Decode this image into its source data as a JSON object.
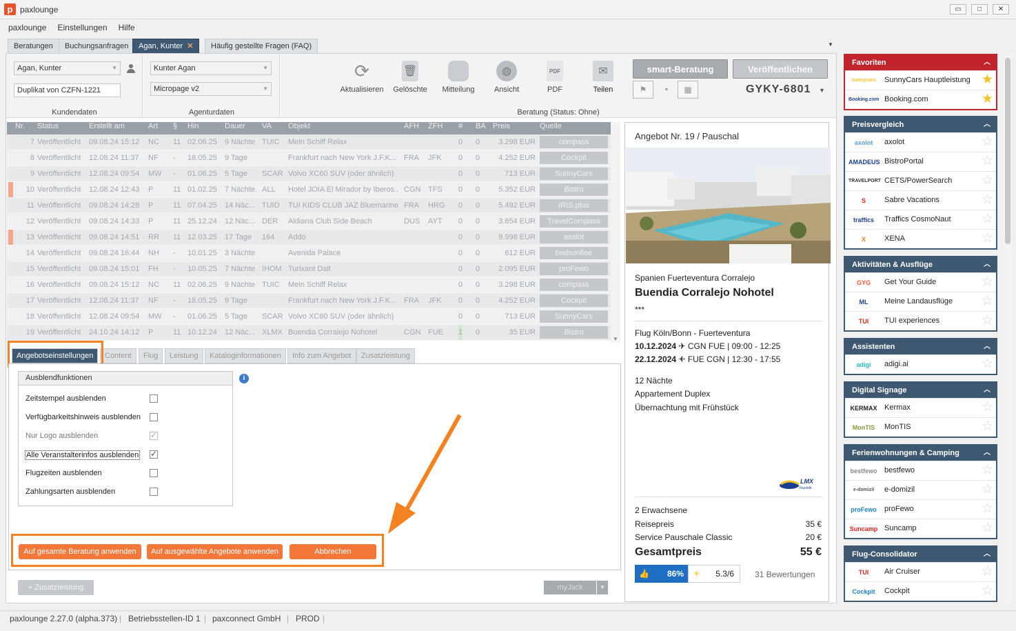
{
  "app": {
    "title": "paxlounge",
    "logo": "p"
  },
  "window_controls": {
    "minimize": "▭",
    "maximize": "□",
    "close": "✕"
  },
  "menu": [
    "paxlounge",
    "Einstellungen",
    "Hilfe"
  ],
  "tabs": [
    {
      "label": "Beratungen"
    },
    {
      "label": "Buchungsanfragen"
    },
    {
      "label": "Agan, Kunter",
      "close": "✕"
    },
    {
      "label": "Häufig gestellte Fragen (FAQ)"
    }
  ],
  "kundendaten": {
    "customer": "Agan, Kunter",
    "copy": "Duplikat von CZFN-1221",
    "label": "Kundendaten"
  },
  "agenturdaten": {
    "agent": "Kunter Agan",
    "template": "Micropage v2",
    "label": "Agenturdaten"
  },
  "toolbar": [
    {
      "label": "Aktualisieren",
      "icon": "refresh-icon"
    },
    {
      "label": "Gelöschte",
      "icon": "trash-icon"
    },
    {
      "label": "Mitteilung",
      "icon": "message-icon"
    },
    {
      "label": "Ansicht",
      "icon": "globe-icon"
    },
    {
      "label": "PDF",
      "icon": "pdf-icon"
    },
    {
      "label": "Teilen",
      "icon": "mail-icon"
    }
  ],
  "beratung": {
    "status_label": "Beratung (Status: Ohne)",
    "smart_button": "smart-Beratung",
    "publish_button": "Veröffentlichen",
    "code": "GYKY-6801"
  },
  "grid": {
    "columns": [
      "Nr.",
      "Status",
      "Erstellt am",
      "Art",
      "§",
      "Hin",
      "Dauer",
      "VA",
      "Objekt",
      "AFH",
      "ZFH",
      "#",
      "BA",
      "Preis",
      "Quelle"
    ],
    "rows": [
      {
        "nr": "7",
        "status": "Veröffentlicht",
        "created": "09.08.24 15:12",
        "art": "NC",
        "par": "11",
        "hin": "02.06.25",
        "dauer": "9 Nächte",
        "va": "TUIC",
        "obj": "Mein Schiff Relax",
        "afh": "",
        "zfh": "",
        "n": "0",
        "ba": "0",
        "preis": "3.298 EUR",
        "quelle": "compass",
        "mark": false
      },
      {
        "nr": "8",
        "status": "Veröffentlicht",
        "created": "12.08.24 11:37",
        "art": "NF",
        "par": "-",
        "hin": "18.05.25",
        "dauer": "9 Tage",
        "va": "",
        "obj": "Frankfurt nach New York J.F.K...",
        "afh": "FRA",
        "zfh": "JFK",
        "n": "0",
        "ba": "0",
        "preis": "4.252 EUR",
        "quelle": "Cockpit",
        "mark": false
      },
      {
        "nr": "9",
        "status": "Veröffentlicht",
        "created": "12.08.24 09:54",
        "art": "MW",
        "par": "-",
        "hin": "01.06.25",
        "dauer": "5 Tage",
        "va": "SCAR",
        "obj": "Volvo XC60 SUV (oder ähnlich)",
        "afh": "",
        "zfh": "",
        "n": "0",
        "ba": "0",
        "preis": "713 EUR",
        "quelle": "SunnyCars",
        "mark": false
      },
      {
        "nr": "10",
        "status": "Veröffentlicht",
        "created": "12.08.24 12:43",
        "art": "P",
        "par": "11",
        "hin": "01.02.25",
        "dauer": "7 Nächte",
        "va": "ALL",
        "obj": "Hotel JOIA El Mirador by Iberos...",
        "afh": "CGN",
        "zfh": "TFS",
        "n": "0",
        "ba": "0",
        "preis": "5.352 EUR",
        "quelle": "Bistro",
        "mark": true
      },
      {
        "nr": "11",
        "status": "Veröffentlicht",
        "created": "09.08.24 14:28",
        "art": "P",
        "par": "11",
        "hin": "07.04.25",
        "dauer": "14 Näc...",
        "va": "TUID",
        "obj": "TUI KIDS CLUB JAZ Bluemarine",
        "afh": "FRA",
        "zfh": "HRG",
        "n": "0",
        "ba": "0",
        "preis": "5.492 EUR",
        "quelle": "IRIS.plus",
        "mark": false
      },
      {
        "nr": "12",
        "status": "Veröffentlicht",
        "created": "09.08.24 14:33",
        "art": "P",
        "par": "11",
        "hin": "25.12.24",
        "dauer": "12 Näc...",
        "va": "DER",
        "obj": "Aldiana Club Side Beach",
        "afh": "DUS",
        "zfh": "AYT",
        "n": "0",
        "ba": "0",
        "preis": "3.854 EUR",
        "quelle": "TravelCompass",
        "mark": false
      },
      {
        "nr": "13",
        "status": "Veröffentlicht",
        "created": "09.08.24 14:51",
        "art": "RR",
        "par": "11",
        "hin": "12.03.25",
        "dauer": "17 Tage",
        "va": "164",
        "obj": "Addo",
        "afh": "",
        "zfh": "",
        "n": "0",
        "ba": "0",
        "preis": "9.998 EUR",
        "quelle": "axolot",
        "mark": true
      },
      {
        "nr": "14",
        "status": "Veröffentlicht",
        "created": "09.08.24 16:44",
        "art": "NH",
        "par": "-",
        "hin": "10.01.25",
        "dauer": "3 Nächte",
        "va": "",
        "obj": "Avenida Palace",
        "afh": "",
        "zfh": "",
        "n": "0",
        "ba": "0",
        "preis": "612 EUR",
        "quelle": "bedsonline",
        "mark": false
      },
      {
        "nr": "15",
        "status": "Veröffentlicht",
        "created": "09.08.24 15:01",
        "art": "FH",
        "par": "-",
        "hin": "10.05.25",
        "dauer": "7 Nächte",
        "va": "IHOM",
        "obj": "Turixant Dalt",
        "afh": "",
        "zfh": "",
        "n": "0",
        "ba": "0",
        "preis": "2.095 EUR",
        "quelle": "proFewo",
        "mark": false
      },
      {
        "nr": "16",
        "status": "Veröffentlicht",
        "created": "09.08.24 15:12",
        "art": "NC",
        "par": "11",
        "hin": "02.06.25",
        "dauer": "9 Nächte",
        "va": "TUIC",
        "obj": "Mein Schiff Relax",
        "afh": "",
        "zfh": "",
        "n": "0",
        "ba": "0",
        "preis": "3.298 EUR",
        "quelle": "compass",
        "mark": false
      },
      {
        "nr": "17",
        "status": "Veröffentlicht",
        "created": "12.08.24 11:37",
        "art": "NF",
        "par": "-",
        "hin": "18.05.25",
        "dauer": "9 Tage",
        "va": "",
        "obj": "Frankfurt nach New York J.F.K...",
        "afh": "FRA",
        "zfh": "JFK",
        "n": "0",
        "ba": "0",
        "preis": "4.252 EUR",
        "quelle": "Cockpit",
        "mark": false
      },
      {
        "nr": "18",
        "status": "Veröffentlicht",
        "created": "12.08.24 09:54",
        "art": "MW",
        "par": "-",
        "hin": "01.06.25",
        "dauer": "5 Tage",
        "va": "SCAR",
        "obj": "Volvo XC60 SUV (oder ähnlich)",
        "afh": "",
        "zfh": "",
        "n": "0",
        "ba": "0",
        "preis": "713 EUR",
        "quelle": "SunnyCars",
        "mark": false
      },
      {
        "nr": "19",
        "status": "Veröffentlicht",
        "created": "24.10.24 14:12",
        "art": "P",
        "par": "11",
        "hin": "10.12.24",
        "dauer": "12 Näc...",
        "va": "XLMX",
        "obj": "Buendia Corralejo Nohotel",
        "afh": "CGN",
        "zfh": "FUE",
        "n": "1",
        "ba": "0",
        "preis": "35 EUR",
        "quelle": "Bistro",
        "mark": false
      }
    ]
  },
  "bottom_tabs": [
    "Angebotseinstellungen",
    "Content",
    "Flug",
    "Leistung",
    "Kataloginformationen",
    "Info zum Angebot",
    "Zusatzleistung"
  ],
  "ausblend": {
    "title": "Ausblendfunktionen",
    "options": [
      {
        "label": "Zeitstempel ausblenden",
        "checked": false,
        "disabled": false
      },
      {
        "label": "Verfügbarkeitshinweis ausblenden",
        "checked": false,
        "disabled": false
      },
      {
        "label": "Nur Logo ausblenden",
        "checked": true,
        "disabled": true
      },
      {
        "label": "Alle Veranstalterinfos ausblenden",
        "checked": true,
        "disabled": false
      },
      {
        "label": "Flugzeiten ausblenden",
        "checked": false,
        "disabled": false
      },
      {
        "label": "Zahlungsarten ausblenden",
        "checked": false,
        "disabled": false
      }
    ]
  },
  "actions": {
    "apply_all": "Auf gesamte Beratung anwenden",
    "apply_selected": "Auf ausgewählte Angebote anwenden",
    "cancel": "Abbrechen",
    "zusatz": "+ Zusatzleistung",
    "myjack": "myJack"
  },
  "offer": {
    "header": "Angebot Nr. 19 / Pauschal",
    "location": "Spanien Fuerteventura Corralejo",
    "hotel": "Buendia Corralejo Nohotel",
    "stars": "***",
    "flight_title": "Flug Köln/Bonn - Fuerteventura",
    "flight_out_date": "10.12.2024",
    "flight_out": "CGN FUE | 09:00 - 12:25",
    "flight_back_date": "22.12.2024",
    "flight_back": "FUE CGN | 12:30 - 17:55",
    "nights": "12 Nächte",
    "room": "Appartement Duplex",
    "board": "Übernachtung mit Frühstück",
    "operator_logo": "LMX Touristik",
    "pax": "2 Erwachsene",
    "price_label": "Reisepreis",
    "price": "35 €",
    "service_label": "Service Pauschale Classic",
    "service": "20 €",
    "total_label": "Gesamtpreis",
    "total": "55 €",
    "recommend": "86%",
    "rating": "5.3/6",
    "reviews": "31 Bewertungen"
  },
  "sidebar": [
    {
      "title": "Favoriten",
      "accent": "#c0232c",
      "items": [
        {
          "name": "SunnyCars Hauptleistung",
          "logo": "sunnycars",
          "color": "#f4c430",
          "fav": true
        },
        {
          "name": "Booking.com",
          "logo": "Booking.com",
          "color": "#1b3f8f",
          "fav": true
        }
      ]
    },
    {
      "title": "Preisvergleich",
      "accent": "#3f5871",
      "items": [
        {
          "name": "axolot",
          "logo": "axolot",
          "color": "#5aa0d8",
          "fav": false
        },
        {
          "name": "BistroPortal",
          "logo": "AMADEUS",
          "color": "#1b3f8f",
          "fav": false
        },
        {
          "name": "CETS/PowerSearch",
          "logo": "TRAVELPORT",
          "color": "#333",
          "fav": false
        },
        {
          "name": "Sabre Vacations",
          "logo": "S",
          "color": "#e2231a",
          "fav": false
        },
        {
          "name": "Traffics CosmoNaut",
          "logo": "traffics",
          "color": "#1b3f8f",
          "fav": false
        },
        {
          "name": "XENA",
          "logo": "X",
          "color": "#f47920",
          "fav": false
        }
      ]
    },
    {
      "title": "Aktivitäten & Ausflüge",
      "accent": "#3f5871",
      "items": [
        {
          "name": "Get Your Guide",
          "logo": "GYG",
          "color": "#ff5533",
          "fav": false
        },
        {
          "name": "Meine Landausflüge",
          "logo": "ML",
          "color": "#1b3f8f",
          "fav": false
        },
        {
          "name": "TUI experiences",
          "logo": "TUI",
          "color": "#e2231a",
          "fav": false
        }
      ]
    },
    {
      "title": "Assistenten",
      "accent": "#3f5871",
      "items": [
        {
          "name": "adigi.ai",
          "logo": "adigi",
          "color": "#2bb5c5",
          "fav": false
        }
      ]
    },
    {
      "title": "Digital Signage",
      "accent": "#3f5871",
      "items": [
        {
          "name": "Kermax",
          "logo": "KERMAX",
          "color": "#222",
          "fav": false
        },
        {
          "name": "MonTIS",
          "logo": "MonTIS",
          "color": "#8a9a3c",
          "fav": false
        }
      ]
    },
    {
      "title": "Ferienwohnungen & Camping",
      "accent": "#3f5871",
      "items": [
        {
          "name": "bestfewo",
          "logo": "bestfewo",
          "color": "#888",
          "fav": false
        },
        {
          "name": "e-domizil",
          "logo": "e-domizil",
          "color": "#555",
          "fav": false
        },
        {
          "name": "proFewo",
          "logo": "proFewo",
          "color": "#1b7fc4",
          "fav": false
        },
        {
          "name": "Suncamp",
          "logo": "Suncamp",
          "color": "#e2231a",
          "fav": false
        }
      ]
    },
    {
      "title": "Flug-Consolidator",
      "accent": "#3f5871",
      "items": [
        {
          "name": "Air Cruiser",
          "logo": "TUI",
          "color": "#e2231a",
          "fav": false
        },
        {
          "name": "Cockpit",
          "logo": "Cockpit",
          "color": "#1b7fc4",
          "fav": false
        }
      ]
    }
  ],
  "status": [
    "paxlounge 2.27.0 (alpha.373)",
    "Betriebsstellen-ID 1",
    "paxconnect GmbH",
    "PROD"
  ],
  "colors": {
    "accent": "#f58220",
    "primary": "#3f5871",
    "favorites": "#c0232c"
  }
}
